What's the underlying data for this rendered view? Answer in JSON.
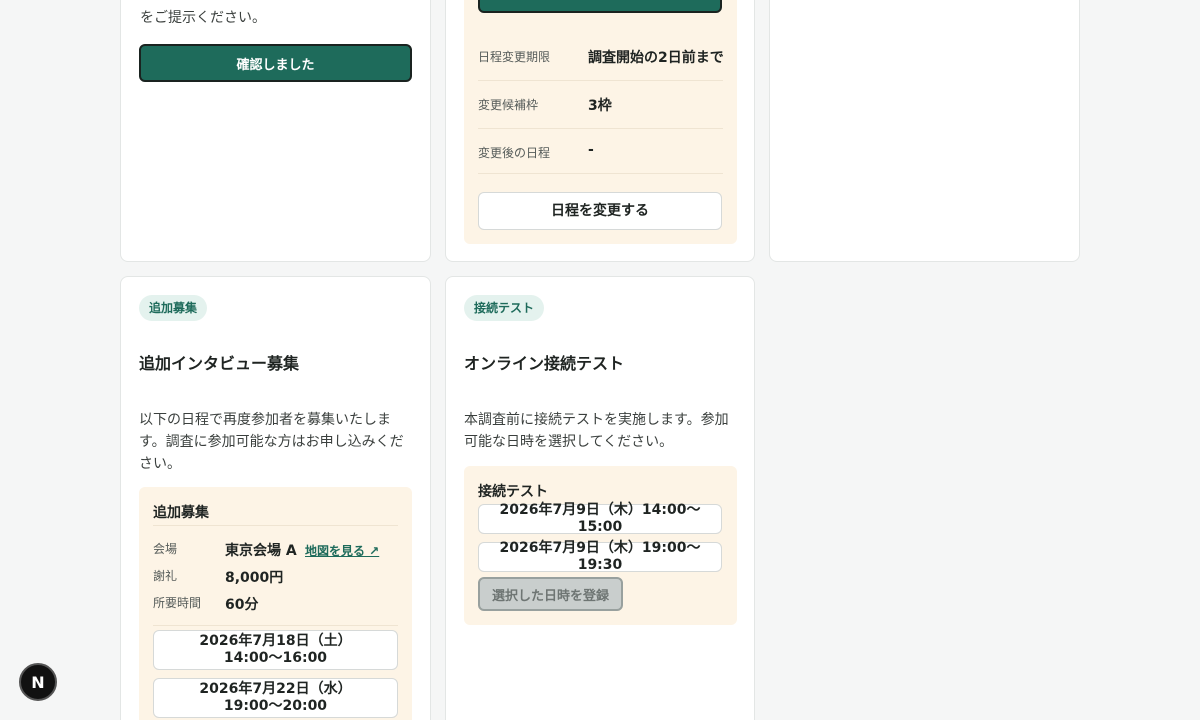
{
  "card1": {
    "text_tail": "をご提示ください。",
    "confirm_button": "確認しました"
  },
  "card2": {
    "rows": [
      {
        "label": "日程変更期限",
        "value": "調査開始の2日前まで"
      },
      {
        "label": "変更候補枠",
        "value": "3枠"
      },
      {
        "label": "変更後の日程",
        "value": "-"
      }
    ],
    "change_button": "日程を変更する"
  },
  "card4": {
    "badge": "追加募集",
    "title": "追加インタビュー募集",
    "description": "以下の日程で再度参加者を募集いたします。調査に参加可能な方はお申し込みください。",
    "panel_title": "追加募集",
    "venue_label": "会場",
    "venue_value": "東京会場 A",
    "map_link": "地図を見る ↗",
    "reward_label": "謝礼",
    "reward_value": "8,000円",
    "duration_label": "所要時間",
    "duration_value": "60分",
    "slots": [
      "2026年7月18日（土）14:00〜16:00",
      "2026年7月22日（水）19:00〜20:00"
    ]
  },
  "card5": {
    "badge": "接続テスト",
    "title": "オンライン接続テスト",
    "description": "本調査前に接続テストを実施します。参加可能な日時を選択してください。",
    "panel_title": "接続テスト",
    "slots": [
      "2026年7月9日（木）14:00〜15:00",
      "2026年7月9日（木）19:00〜19:30"
    ],
    "submit_button": "選択した日時を登録"
  },
  "fab_label": "N"
}
